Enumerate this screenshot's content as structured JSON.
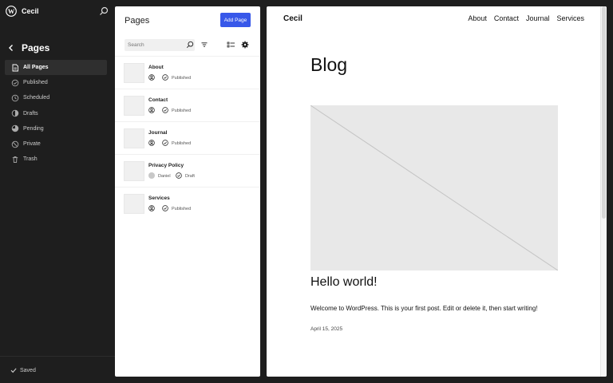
{
  "site": {
    "name": "Cecil"
  },
  "sidebar": {
    "title": "Pages",
    "items": [
      {
        "label": "All Pages",
        "icon": "pages-icon",
        "active": true
      },
      {
        "label": "Published",
        "icon": "published-icon"
      },
      {
        "label": "Scheduled",
        "icon": "scheduled-icon"
      },
      {
        "label": "Drafts",
        "icon": "drafts-icon"
      },
      {
        "label": "Pending",
        "icon": "pending-icon"
      },
      {
        "label": "Private",
        "icon": "private-icon"
      },
      {
        "label": "Trash",
        "icon": "trash-icon"
      }
    ],
    "saved_label": "Saved"
  },
  "pages_panel": {
    "title": "Pages",
    "add_button": "Add Page",
    "search_placeholder": "Search",
    "rows": [
      {
        "title": "About",
        "author": "",
        "status": "Published"
      },
      {
        "title": "Contact",
        "author": "",
        "status": "Published"
      },
      {
        "title": "Journal",
        "author": "",
        "status": "Published"
      },
      {
        "title": "Privacy Policy",
        "author": "Daniel",
        "status": "Draft"
      },
      {
        "title": "Services",
        "author": "",
        "status": "Published"
      }
    ]
  },
  "preview": {
    "site_title": "Cecil",
    "nav": [
      "About",
      "Contact",
      "Journal",
      "Services"
    ],
    "heading": "Blog",
    "post_title": "Hello world!",
    "excerpt": "Welcome to WordPress. This is your first post. Edit or delete it, then start writing!",
    "date": "April 15, 2025"
  },
  "colors": {
    "accent": "#3858e9",
    "sidebar_bg": "#1e1e1e",
    "active_item_bg": "#2f2f2f"
  }
}
